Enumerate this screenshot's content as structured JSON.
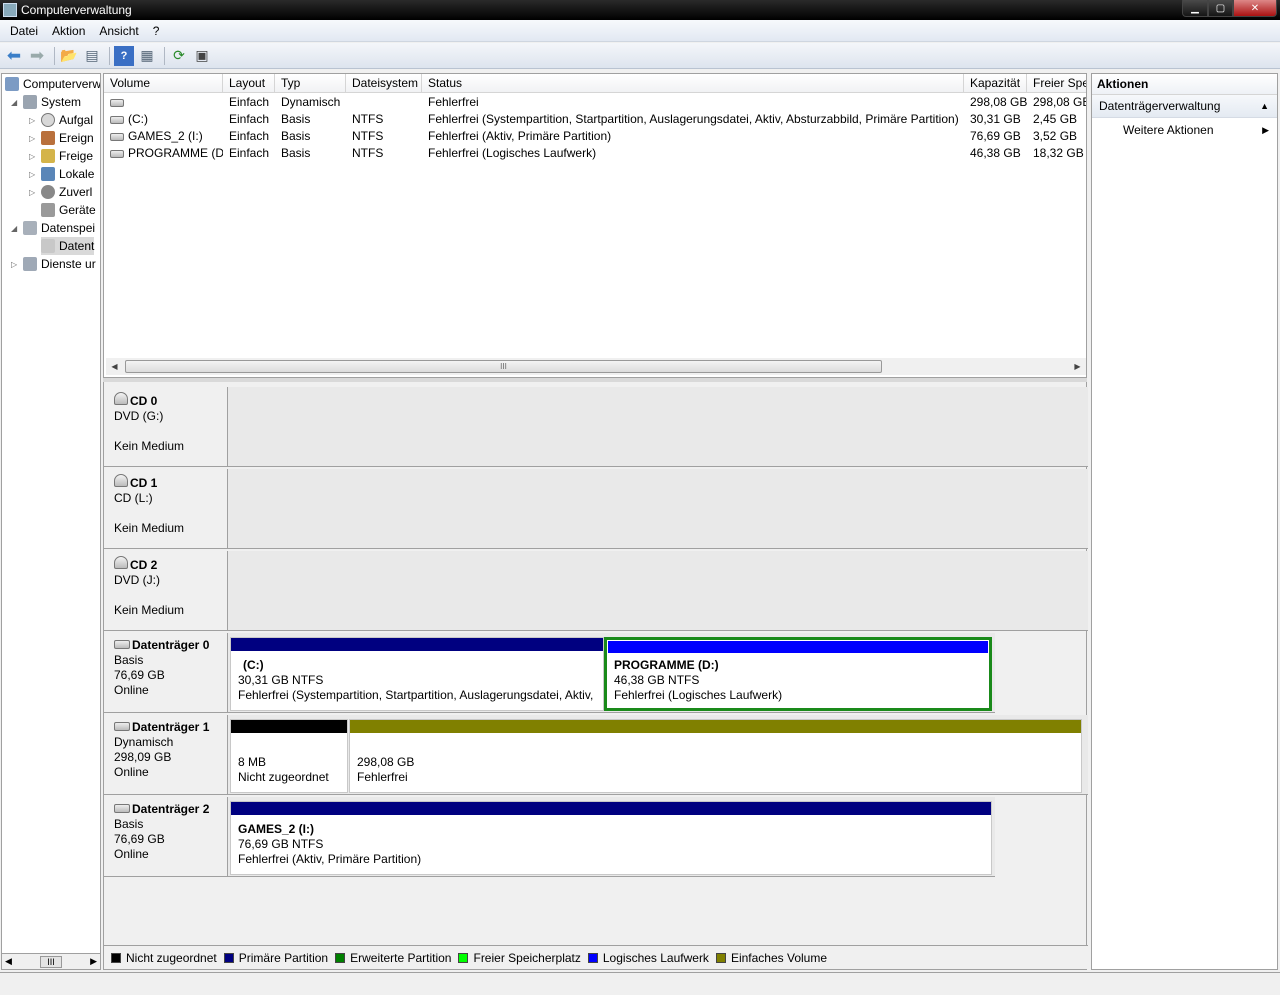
{
  "window": {
    "title": "Computerverwaltung"
  },
  "menu": [
    "Datei",
    "Aktion",
    "Ansicht",
    "?"
  ],
  "tree": {
    "items": [
      {
        "label": "Computerverw",
        "level": 0
      },
      {
        "label": "System",
        "level": 1
      },
      {
        "label": "Aufgal",
        "level": 2
      },
      {
        "label": "Ereign",
        "level": 2
      },
      {
        "label": "Freige",
        "level": 2
      },
      {
        "label": "Lokale",
        "level": 2
      },
      {
        "label": "Zuverl",
        "level": 2
      },
      {
        "label": "Geräte",
        "level": 2
      },
      {
        "label": "Datenspei",
        "level": 1
      },
      {
        "label": "Datent",
        "level": 2
      },
      {
        "label": "Dienste ur",
        "level": 1
      }
    ]
  },
  "volume_list": {
    "columns": [
      "Volume",
      "Layout",
      "Typ",
      "Dateisystem",
      "Status",
      "Kapazität",
      "Freier Spe"
    ],
    "rows": [
      {
        "volume": "",
        "layout": "Einfach",
        "typ": "Dynamisch",
        "fs": "",
        "status": "Fehlerfrei",
        "cap": "298,08 GB",
        "free": "298,08 GB"
      },
      {
        "volume": "(C:)",
        "layout": "Einfach",
        "typ": "Basis",
        "fs": "NTFS",
        "status": "Fehlerfrei (Systempartition, Startpartition, Auslagerungsdatei, Aktiv, Absturzabbild, Primäre Partition)",
        "cap": "30,31 GB",
        "free": "2,45 GB"
      },
      {
        "volume": "GAMES_2 (I:)",
        "layout": "Einfach",
        "typ": "Basis",
        "fs": "NTFS",
        "status": "Fehlerfrei (Aktiv, Primäre Partition)",
        "cap": "76,69 GB",
        "free": "3,52 GB"
      },
      {
        "volume": "PROGRAMME (D:)",
        "layout": "Einfach",
        "typ": "Basis",
        "fs": "NTFS",
        "status": "Fehlerfrei (Logisches Laufwerk)",
        "cap": "46,38 GB",
        "free": "18,32 GB"
      }
    ],
    "scroll_thumb": "III"
  },
  "disks": [
    {
      "name": "CD 0",
      "l1": "DVD (G:)",
      "l2": "",
      "l3": "Kein Medium"
    },
    {
      "name": "CD 1",
      "l1": "CD (L:)",
      "l2": "",
      "l3": "Kein Medium"
    },
    {
      "name": "CD 2",
      "l1": "DVD (J:)",
      "l2": "",
      "l3": "Kein Medium"
    },
    {
      "name": "Datenträger 0",
      "l1": "Basis",
      "l2": "76,69 GB",
      "l3": "Online"
    },
    {
      "name": "Datenträger 1",
      "l1": "Dynamisch",
      "l2": "298,09 GB",
      "l3": "Online"
    },
    {
      "name": "Datenträger 2",
      "l1": "Basis",
      "l2": "76,69 GB",
      "l3": "Online"
    }
  ],
  "partitions": {
    "d0_c": {
      "title": "(C:)",
      "size": "30,31 GB NTFS",
      "status": "Fehlerfrei (Systempartition, Startpartition, Auslagerungsdatei, Aktiv,"
    },
    "d0_d": {
      "title": "PROGRAMME  (D:)",
      "size": "46,38 GB NTFS",
      "status": "Fehlerfrei (Logisches Laufwerk)"
    },
    "d1_unalloc": {
      "title": "",
      "size": "8 MB",
      "status": "Nicht zugeordnet"
    },
    "d1_vol": {
      "title": "",
      "size": "298,08 GB",
      "status": "Fehlerfrei"
    },
    "d2_games": {
      "title": "GAMES_2  (I:)",
      "size": "76,69 GB NTFS",
      "status": "Fehlerfrei (Aktiv, Primäre Partition)"
    }
  },
  "legend": [
    {
      "label": "Nicht zugeordnet",
      "color": "#000000"
    },
    {
      "label": "Primäre Partition",
      "color": "#000080"
    },
    {
      "label": "Erweiterte Partition",
      "color": "#008000"
    },
    {
      "label": "Freier Speicherplatz",
      "color": "#00ff00"
    },
    {
      "label": "Logisches Laufwerk",
      "color": "#0000ff"
    },
    {
      "label": "Einfaches Volume",
      "color": "#808000"
    }
  ],
  "actions": {
    "header": "Aktionen",
    "section": "Datenträgerverwaltung",
    "item": "Weitere Aktionen"
  }
}
